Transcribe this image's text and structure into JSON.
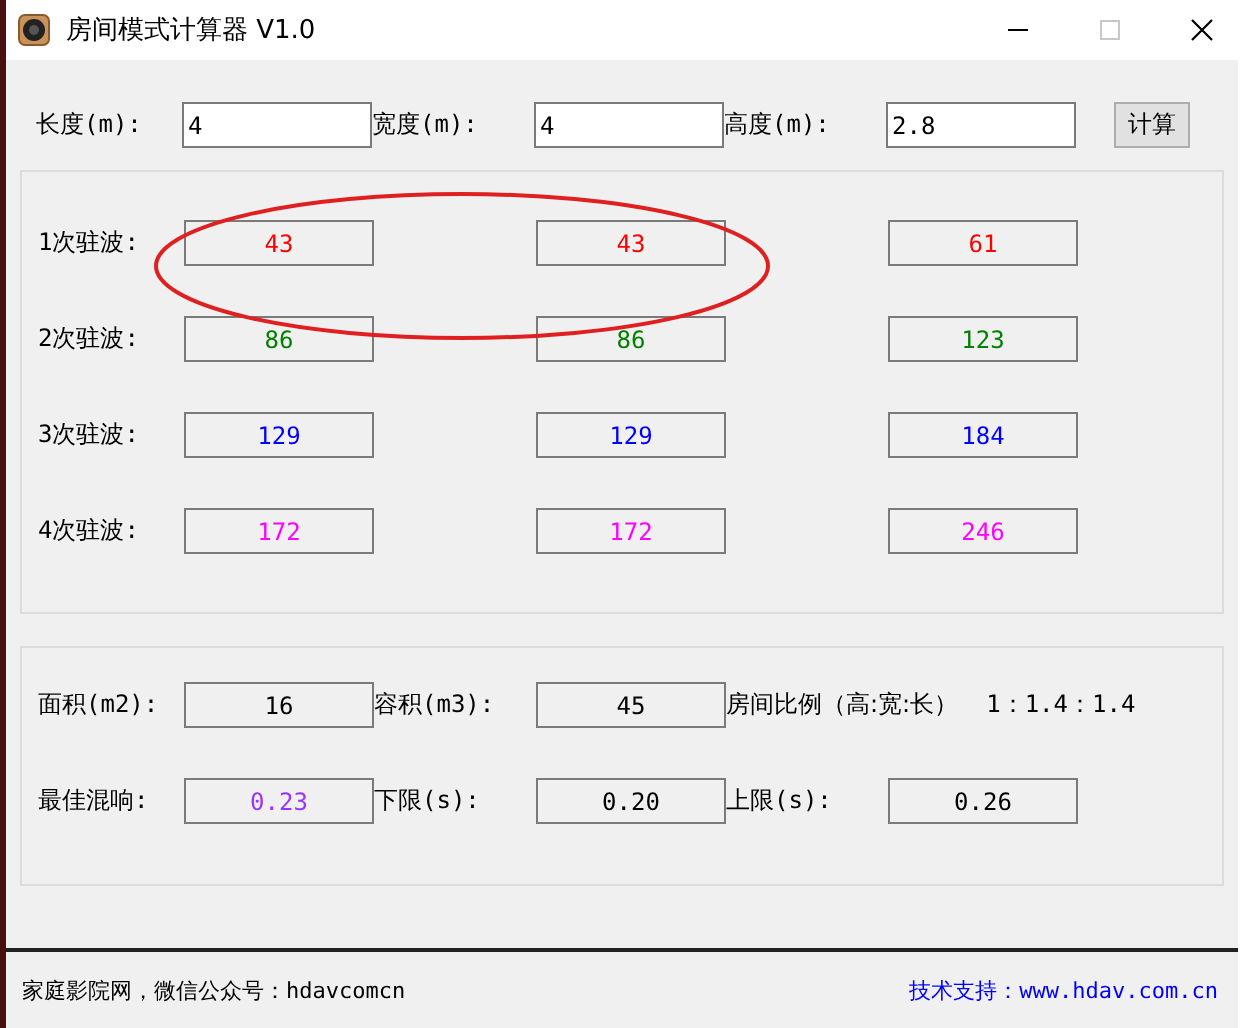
{
  "window": {
    "title": "房间模式计算器  V1.0",
    "maximize_disabled": true
  },
  "inputs": [
    {
      "label": "长度(m):",
      "value": "4"
    },
    {
      "label": "宽度(m):",
      "value": "4"
    },
    {
      "label": "高度(m):",
      "value": "2.8"
    }
  ],
  "calculate_button": "计算",
  "modes": [
    {
      "label": "1次驻波:",
      "color": "#ff0000",
      "values": [
        "43",
        "43",
        "61"
      ]
    },
    {
      "label": "2次驻波:",
      "color": "#008000",
      "values": [
        "86",
        "86",
        "123"
      ]
    },
    {
      "label": "3次驻波:",
      "color": "#0000ff",
      "values": [
        "129",
        "129",
        "184"
      ]
    },
    {
      "label": "4次驻波:",
      "color": "#ff00ff",
      "values": [
        "172",
        "172",
        "246"
      ]
    }
  ],
  "highlight": {
    "kind": "ellipse",
    "color": "#e02020"
  },
  "results": [
    {
      "label": "面积(m2):",
      "value": "16",
      "color": "#000000"
    },
    {
      "label": "容积(m3):",
      "value": "45",
      "color": "#000000"
    },
    {
      "label": "最佳混响:",
      "value": "0.23",
      "color": "#9933ff"
    },
    {
      "label": "下限(s):",
      "value": "0.20",
      "color": "#000000"
    },
    {
      "label": "上限(s):",
      "value": "0.26",
      "color": "#000000"
    }
  ],
  "ratio": {
    "label": "房间比例（高:宽:长）",
    "value": "1：1.4：1.4"
  },
  "status_bar": {
    "left": "家庭影院网，微信公众号：hdavcomcn",
    "right": "技术支持：www.hdav.com.cn"
  }
}
